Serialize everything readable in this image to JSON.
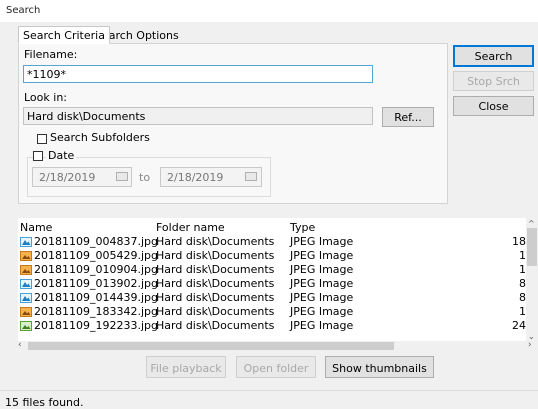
{
  "window": {
    "title": "Search"
  },
  "tabs": [
    {
      "label": "Search Criteria"
    },
    {
      "label": "Search Options"
    }
  ],
  "criteria": {
    "filename_label": "Filename:",
    "filename_value": "*1109*",
    "lookin_label": "Look in:",
    "lookin_value": "Hard disk\\Documents",
    "ref_label": "Ref...",
    "subfolders_label": "Search Subfolders",
    "date_label": "Date",
    "date_from": "2/18/2019",
    "date_to_label": "to",
    "date_to": "2/18/2019"
  },
  "side_buttons": {
    "search": "Search",
    "stop": "Stop Srch",
    "close": "Close"
  },
  "results": {
    "columns": [
      "Name",
      "Folder name",
      "Type"
    ],
    "rows": [
      {
        "name": "20181109_004837.jpg",
        "folder": "Hard disk\\Documents",
        "type": "JPEG Image",
        "size": "18",
        "icon": "image-blue-icon"
      },
      {
        "name": "20181109_005429.jpg",
        "folder": "Hard disk\\Documents",
        "type": "JPEG Image",
        "size": "1",
        "icon": "image-orange-icon"
      },
      {
        "name": "20181109_010904.jpg",
        "folder": "Hard disk\\Documents",
        "type": "JPEG Image",
        "size": "1",
        "icon": "image-orange-icon"
      },
      {
        "name": "20181109_013902.jpg",
        "folder": "Hard disk\\Documents",
        "type": "JPEG Image",
        "size": "8",
        "icon": "image-blue-icon"
      },
      {
        "name": "20181109_014439.jpg",
        "folder": "Hard disk\\Documents",
        "type": "JPEG Image",
        "size": "8",
        "icon": "image-blue-icon"
      },
      {
        "name": "20181109_183342.jpg",
        "folder": "Hard disk\\Documents",
        "type": "JPEG Image",
        "size": "1",
        "icon": "image-orange-icon"
      },
      {
        "name": "20181109_192233.jpg",
        "folder": "Hard disk\\Documents",
        "type": "JPEG Image",
        "size": "24",
        "icon": "image-green-icon"
      }
    ]
  },
  "bottom_buttons": {
    "playback": "File playback",
    "open_folder": "Open folder",
    "thumbnails": "Show thumbnails"
  },
  "status": {
    "text": "15 files found."
  },
  "colors": {
    "accent": "#0078d7",
    "focus_border": "#53a6d4",
    "disabled_text": "#a8a8a8"
  }
}
